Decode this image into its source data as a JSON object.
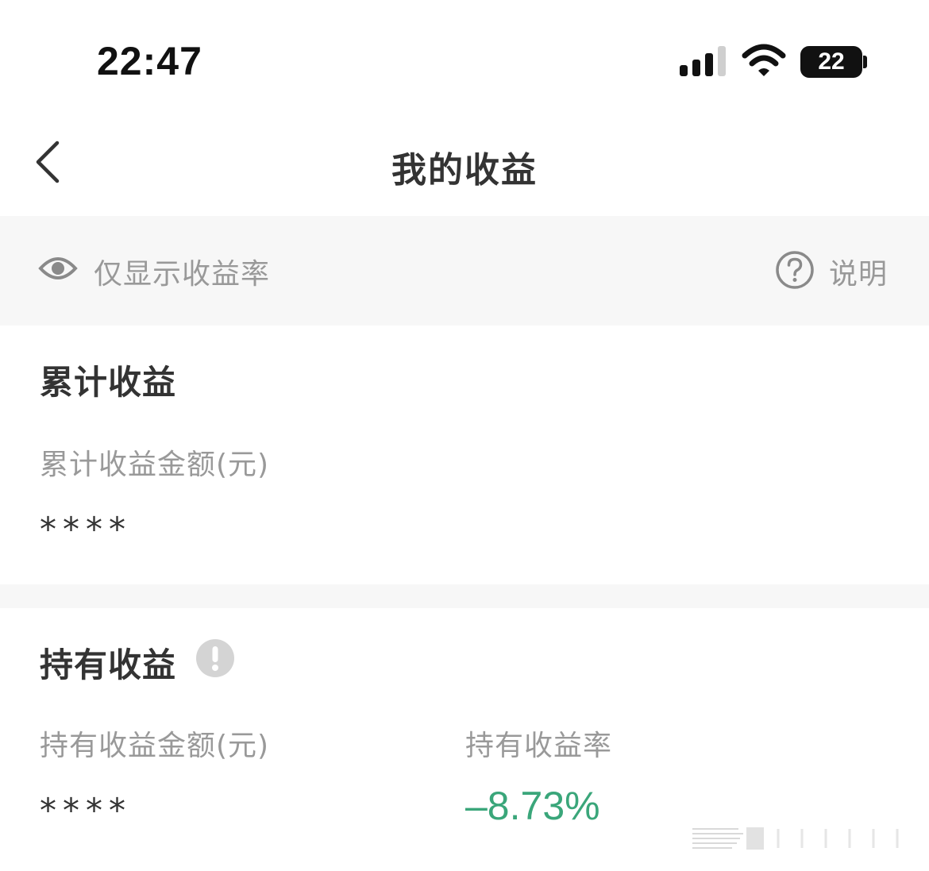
{
  "status_bar": {
    "time": "22:47",
    "battery_level": "22",
    "signal_icon": "cellular-signal-icon",
    "wifi_icon": "wifi-icon"
  },
  "nav": {
    "title": "我的收益",
    "back_icon": "back-chevron-icon"
  },
  "toggle_row": {
    "eye_icon": "eye-icon",
    "toggle_label": "仅显示收益率",
    "help_icon": "question-circle-icon",
    "help_label": "说明"
  },
  "total_earnings": {
    "title": "累计收益",
    "amount_label": "累计收益金额(元)",
    "amount_value": "****"
  },
  "holding_earnings": {
    "title": "持有收益",
    "info_icon": "exclamation-circle-icon",
    "amount_label": "持有收益金额(元)",
    "amount_value": "****",
    "rate_label": "持有收益率",
    "rate_value": "–8.73%"
  },
  "colors": {
    "negative_rate": "#3aa67a",
    "muted_text": "#999999",
    "section_bg": "#f7f7f7"
  }
}
